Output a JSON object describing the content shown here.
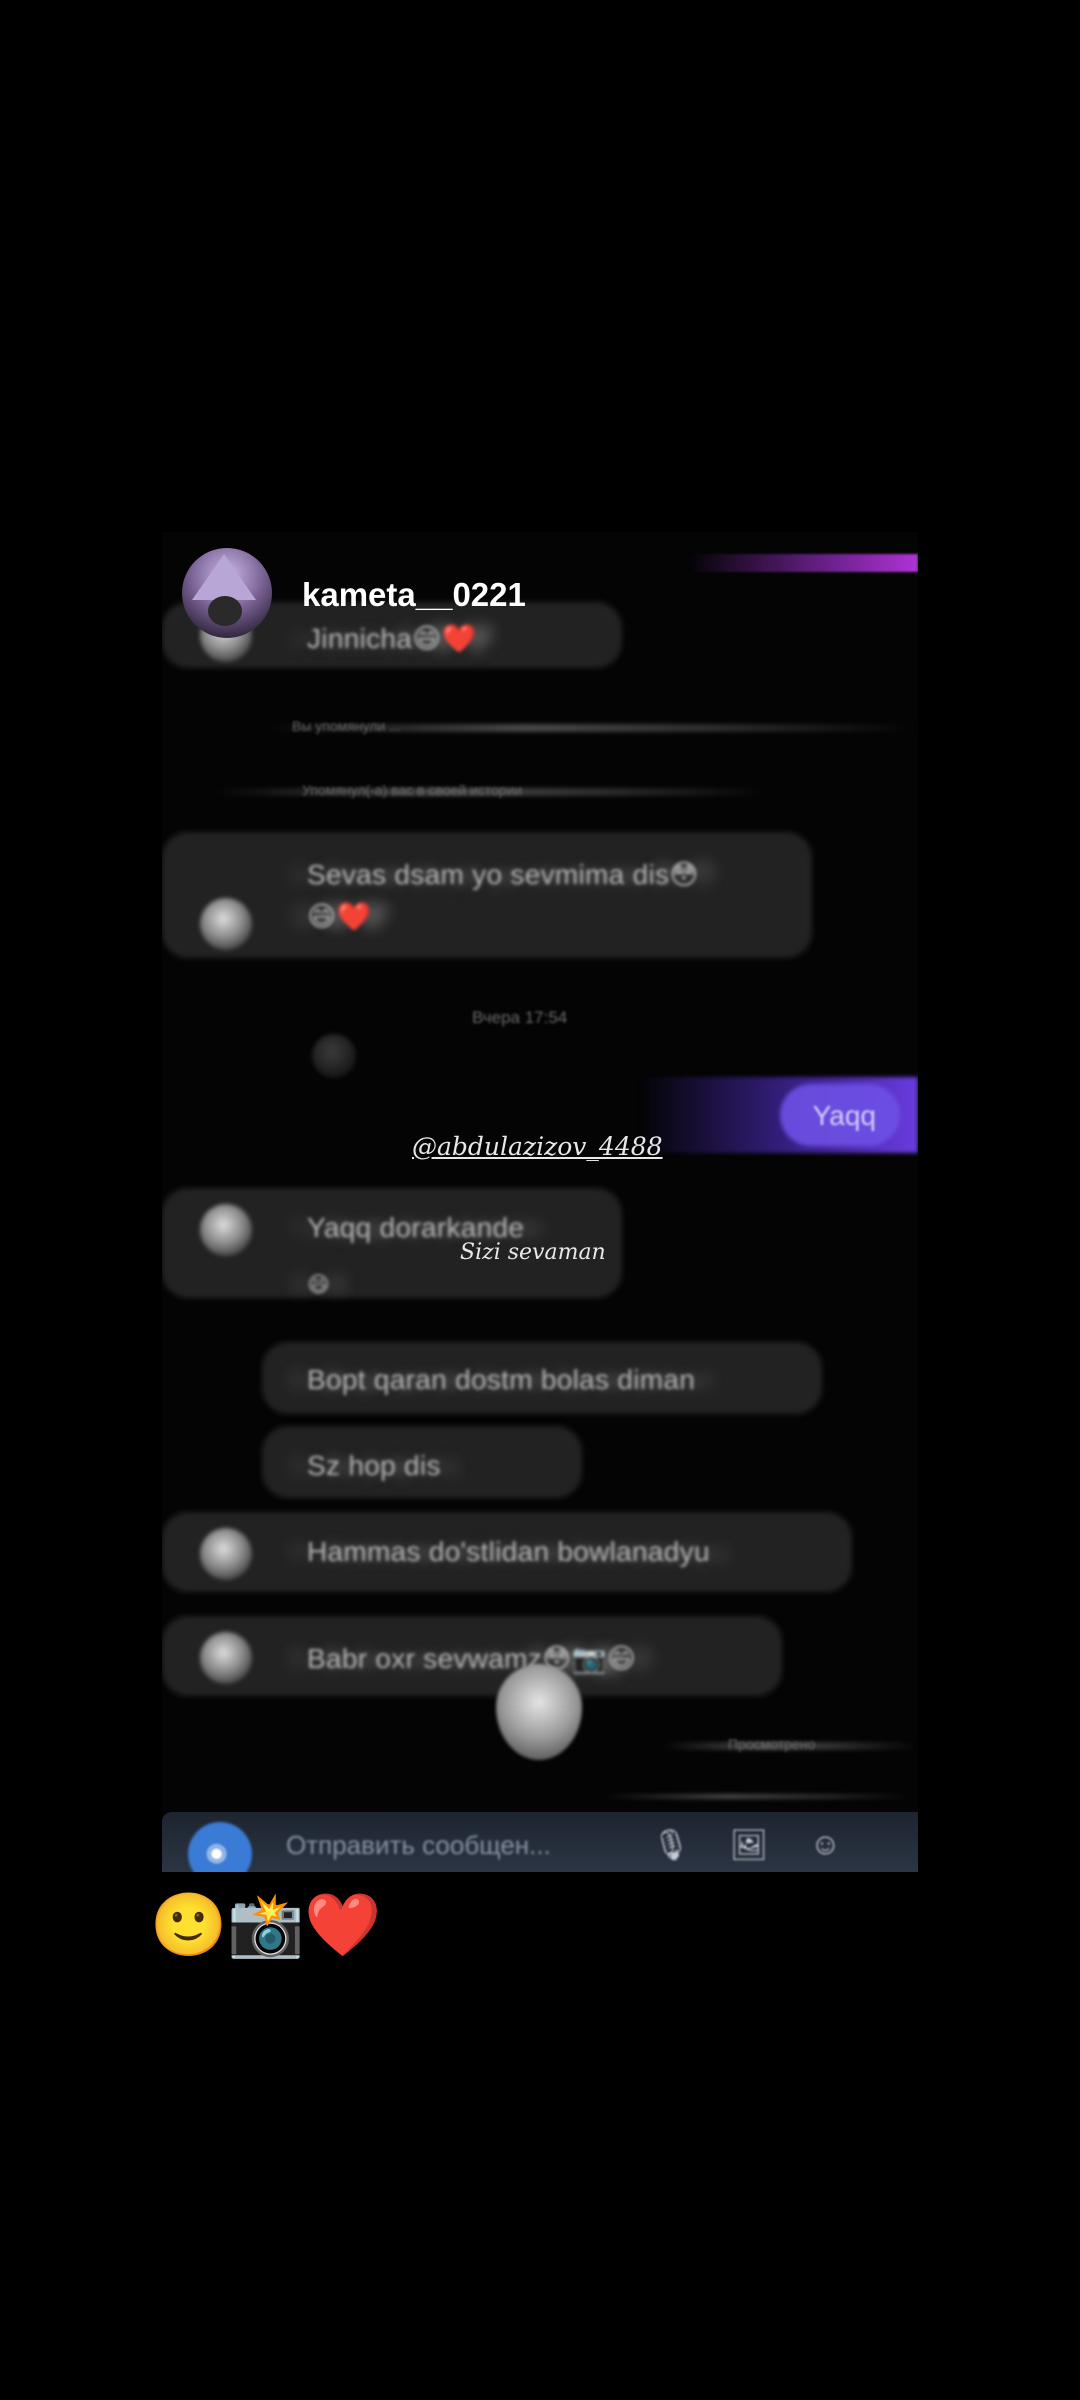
{
  "post": {
    "username": "kameta__0221",
    "caption": "🙂📸❤️"
  },
  "video": {
    "messages": {
      "m1": "Jinnicha😄❤️",
      "m2": "Sevas dsam yo sevmima dis😳",
      "m2b": "😄❤️",
      "m3": "Yaqq dorarkande",
      "m3b": "😄",
      "m4": "Bopt qaran dostm bolas diman",
      "m5": "Sz hop dis",
      "m6": "Hammas do'stlidan bowlanadyu",
      "m7": "Babr oxr sevwamz😳📷😄"
    },
    "outgoing_message": "Yaqq",
    "system_text": {
      "s1": "Вы упомянули ...",
      "s2": "Упомянул(-а) вас в своей истории",
      "date": "Вчера 17:54",
      "seen": "Просмотрено"
    },
    "watermark": "@abdulazizov_4488",
    "watermark_sub": "Sizi sevaman",
    "input_placeholder": "Отправить сообщен..."
  },
  "colors": {
    "background": "#000000",
    "outgoing_bubble": "#6a3be0",
    "camera_button": "#3a7bd5"
  },
  "icons": {
    "camera": "camera-icon",
    "mic": "microphone-icon",
    "gallery": "gallery-icon",
    "sticker": "sticker-icon"
  }
}
